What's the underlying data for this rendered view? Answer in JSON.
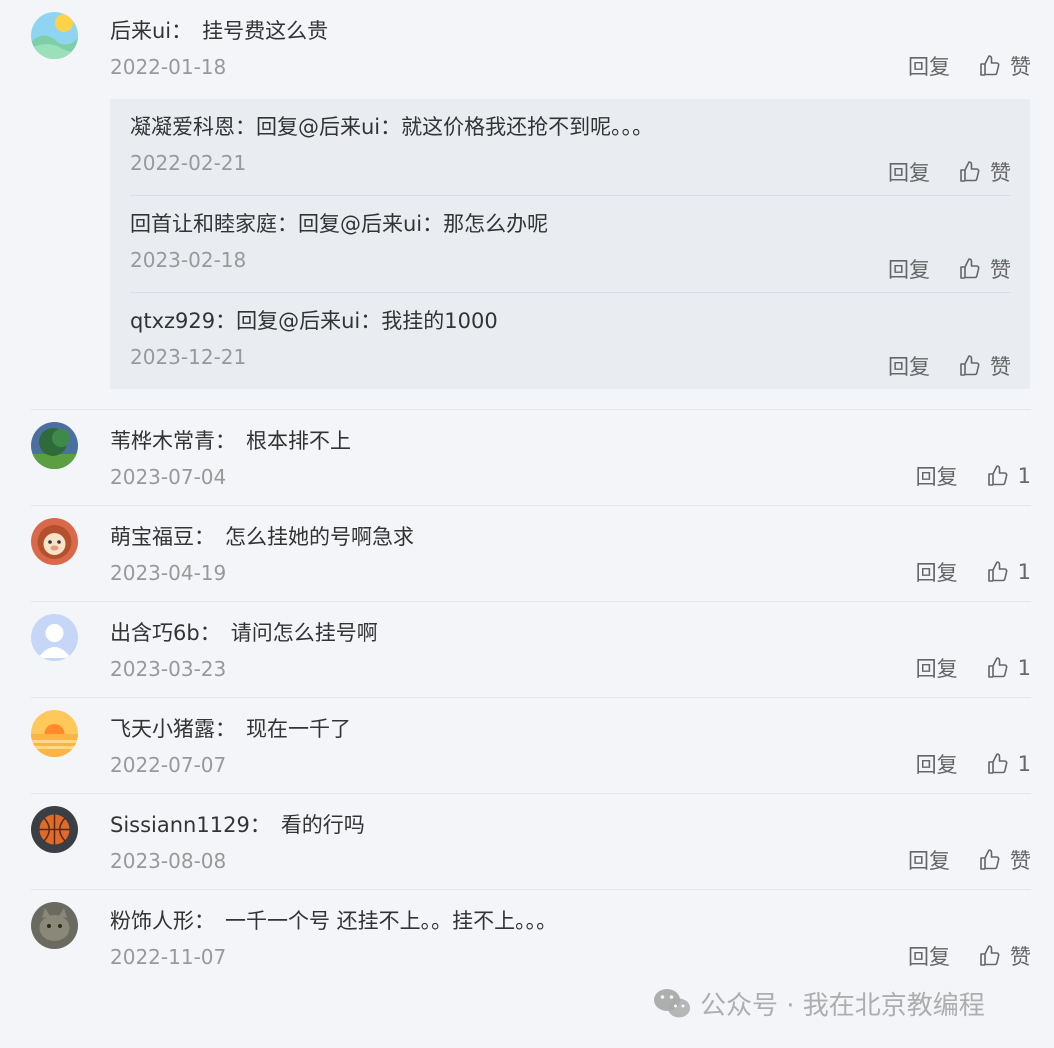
{
  "labels": {
    "reply": "回复",
    "like": "赞",
    "colon": "："
  },
  "comments": [
    {
      "user": "后来ui",
      "content": "挂号费这么贵",
      "date": "2022-01-18",
      "likes": "赞",
      "avatar": "landscape",
      "replies": [
        {
          "user": "凝凝爱科恩",
          "content": "回复@后来ui：就这价格我还抢不到呢。。。",
          "date": "2022-02-21",
          "likes": "赞"
        },
        {
          "user": "回首让和睦家庭",
          "content": "回复@后来ui：那怎么办呢",
          "date": "2023-02-18",
          "likes": "赞"
        },
        {
          "user": "qtxz929",
          "content": "回复@后来ui：我挂的1000",
          "date": "2023-12-21",
          "likes": "赞"
        }
      ]
    },
    {
      "user": "苇桦木常青",
      "content": "根本排不上",
      "date": "2023-07-04",
      "likes": "1",
      "avatar": "tree"
    },
    {
      "user": "萌宝福豆",
      "content": "怎么挂她的号啊急求",
      "date": "2023-04-19",
      "likes": "1",
      "avatar": "lion"
    },
    {
      "user": "出含巧6b",
      "content": "请问怎么挂号啊",
      "date": "2023-03-23",
      "likes": "1",
      "avatar": "default"
    },
    {
      "user": "飞天小猪露",
      "content": "现在一千了",
      "date": "2022-07-07",
      "likes": "1",
      "avatar": "sunset"
    },
    {
      "user": "Sissiann1129",
      "content": "看的行吗",
      "date": "2023-08-08",
      "likes": "赞",
      "avatar": "basketball"
    },
    {
      "user": "粉饰人形",
      "content": "一千一个号 还挂不上。。挂不上。。。",
      "date": "2022-11-07",
      "likes": "赞",
      "avatar": "cat"
    }
  ],
  "watermark": {
    "text": "公众号 · 我在北京教编程",
    "icon": "wechat-icon"
  }
}
